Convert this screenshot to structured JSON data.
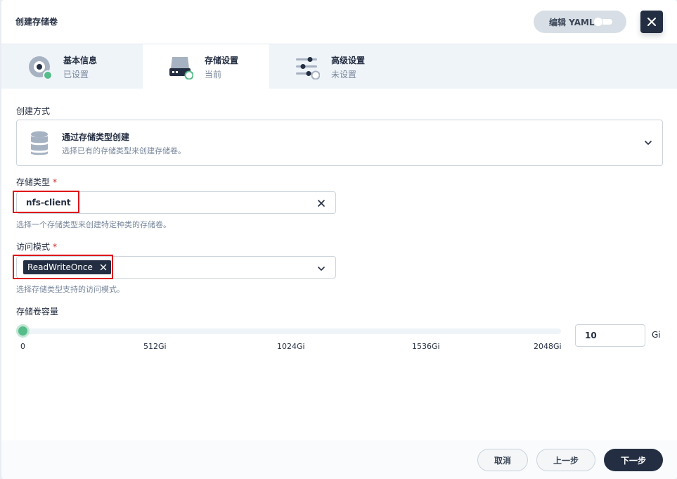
{
  "header": {
    "title": "创建存储卷",
    "yaml_label": "编辑 YAML"
  },
  "steps": [
    {
      "name": "基本信息",
      "status": "已设置"
    },
    {
      "name": "存储设置",
      "status": "当前"
    },
    {
      "name": "高级设置",
      "status": "未设置"
    }
  ],
  "method": {
    "label": "创建方式",
    "title": "通过存储类型创建",
    "description": "选择已有的存储类型来创建存储卷。"
  },
  "storage_class": {
    "label": "存储类型",
    "required_mark": "*",
    "value": "nfs-client",
    "hint": "选择一个存储类型来创建特定种类的存储卷。"
  },
  "access_mode": {
    "label": "访问模式",
    "required_mark": "*",
    "tag": "ReadWriteOnce",
    "hint": "选择存储类型支持的访问模式。"
  },
  "capacity": {
    "label": "存储卷容量",
    "slider_fraction": 0,
    "ticks": [
      "0",
      "512Gi",
      "1024Gi",
      "1536Gi",
      "2048Gi"
    ],
    "value": "10",
    "unit": "Gi"
  },
  "footer": {
    "cancel": "取消",
    "previous": "上一步",
    "next": "下一步"
  },
  "colors": {
    "primary": "#242e42",
    "accent_green": "#55bc8a",
    "highlight_red": "#e0151a"
  },
  "icons": [
    "close-icon",
    "disc-icon",
    "hard-drive-icon",
    "sliders-icon",
    "database-icon",
    "chevron-down-icon",
    "clear-icon",
    "tag-remove-icon"
  ]
}
